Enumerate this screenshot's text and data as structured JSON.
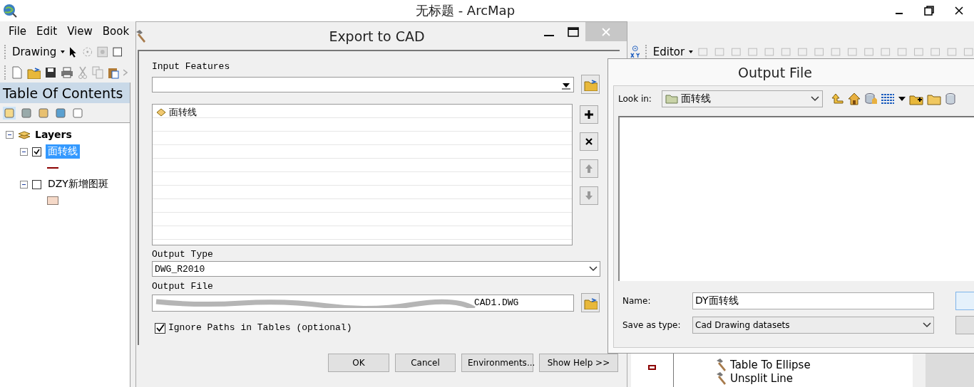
{
  "arcmap": {
    "title": "无标题 - ArcMap",
    "menu": [
      "File",
      "Edit",
      "View",
      "Book"
    ],
    "drawing_toolbar": {
      "label": "Drawing"
    },
    "editor_toolbar": {
      "label": "Editor"
    },
    "toc": {
      "title": "Table Of Contents",
      "root": {
        "label": "Layers",
        "expanded": true,
        "children": [
          {
            "label": "面转线",
            "checked": true,
            "selected": true,
            "expanded": true,
            "kind": "line"
          },
          {
            "label": "DZY新增图斑",
            "checked": false,
            "selected": false,
            "expanded": true,
            "kind": "polygon"
          }
        ]
      }
    },
    "toolbox_items": [
      "Table To Ellipse",
      "Unsplit Line"
    ]
  },
  "export_to_cad": {
    "title": "Export to CAD",
    "input_features": {
      "label": "Input Features"
    },
    "features": [
      {
        "label": "面转线"
      }
    ],
    "output_type": {
      "label": "Output Type",
      "value": "DWG_R2010"
    },
    "output_file": {
      "label": "Output File",
      "value": "CAD1.DWG"
    },
    "ignore_paths": {
      "label": "Ignore Paths in Tables (optional)",
      "checked": true
    },
    "buttons": [
      "OK",
      "Cancel",
      "Environments...",
      "Show Help >>"
    ]
  },
  "output_file_dialog": {
    "title": "Output File",
    "look_in": {
      "label": "Look in:",
      "value": "面转线"
    },
    "name": {
      "label": "Name:",
      "value": "DY面转线"
    },
    "save_as_type": {
      "label": "Save as type:",
      "value": "Cad Drawing datasets"
    }
  }
}
